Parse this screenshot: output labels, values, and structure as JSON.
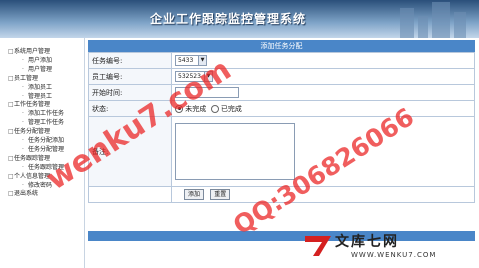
{
  "banner": {
    "title": "企业工作跟踪监控管理系统"
  },
  "sidebar": {
    "items": [
      {
        "label": "系统用户管理",
        "level": 0
      },
      {
        "label": "用户添加",
        "level": 1
      },
      {
        "label": "用户管理",
        "level": 1
      },
      {
        "label": "员工管理",
        "level": 0
      },
      {
        "label": "添加员工",
        "level": 1
      },
      {
        "label": "管理员工",
        "level": 1
      },
      {
        "label": "工作任务管理",
        "level": 0
      },
      {
        "label": "添加工作任务",
        "level": 1
      },
      {
        "label": "管理工作任务",
        "level": 1
      },
      {
        "label": "任务分配管理",
        "level": 0
      },
      {
        "label": "任务分配添加",
        "level": 1
      },
      {
        "label": "任务分配管理",
        "level": 1
      },
      {
        "label": "任务跟踪管理",
        "level": 0
      },
      {
        "label": "任务跟踪管理",
        "level": 1
      },
      {
        "label": "个人信息管理",
        "level": 0
      },
      {
        "label": "修改密码",
        "level": 1
      },
      {
        "label": "退出系统",
        "level": 0
      }
    ]
  },
  "form": {
    "header": "添加任务分配",
    "task_no_label": "任务编号:",
    "task_no_value": "5433",
    "emp_no_label": "员工编号:",
    "emp_no_value": "532523",
    "start_label": "开始时间:",
    "start_value": "",
    "status_label": "状态:",
    "status_option1": "未完成",
    "status_option2": "已完成",
    "status_selected": "未完成",
    "remark_label": "备注:",
    "add_button": "添加",
    "reset_button": "重置"
  },
  "watermarks": {
    "site": "wenku7.com",
    "qq": "QQ:306826066"
  },
  "logo": {
    "cn": "文库七网",
    "en": "WWW.WENKU7.COM",
    "red": "#d42020"
  }
}
